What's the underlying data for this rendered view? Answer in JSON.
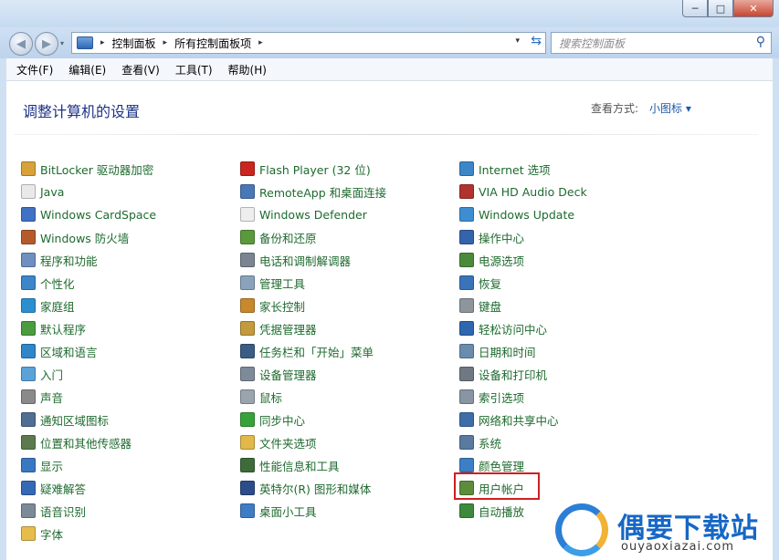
{
  "window": {
    "minimize": "─",
    "maximize": "□",
    "close": "✕"
  },
  "nav": {
    "back_glyph": "◀",
    "forward_glyph": "▶",
    "dropdown_glyph": "▾"
  },
  "address": {
    "crumbs": [
      "控制面板",
      "所有控制面板项"
    ],
    "separator": "▸",
    "dropdown_glyph": "▾",
    "refresh_glyph": "⇆"
  },
  "search": {
    "placeholder": "搜索控制面板",
    "icon_glyph": "⚲"
  },
  "menu": [
    "文件(F)",
    "编辑(E)",
    "查看(V)",
    "工具(T)",
    "帮助(H)"
  ],
  "page": {
    "title": "调整计算机的设置",
    "view_label": "查看方式:",
    "view_value": "小图标 ▾"
  },
  "items": [
    {
      "label": "BitLocker 驱动器加密",
      "icon": "key-icon",
      "color": "#d8a23a"
    },
    {
      "label": "Java",
      "icon": "document-icon",
      "color": "#e9e9e9"
    },
    {
      "label": "Windows CardSpace",
      "icon": "cardspace-icon",
      "color": "#3f72c4"
    },
    {
      "label": "Windows 防火墙",
      "icon": "firewall-icon",
      "color": "#b65a2c"
    },
    {
      "label": "程序和功能",
      "icon": "programs-icon",
      "color": "#6e8fbf"
    },
    {
      "label": "个性化",
      "icon": "personalize-icon",
      "color": "#3d86c9"
    },
    {
      "label": "家庭组",
      "icon": "homegroup-icon",
      "color": "#2b8fd0"
    },
    {
      "label": "默认程序",
      "icon": "default-programs-icon",
      "color": "#4a9c3f"
    },
    {
      "label": "区域和语言",
      "icon": "globe-icon",
      "color": "#2f86c9"
    },
    {
      "label": "入门",
      "icon": "getting-started-icon",
      "color": "#5aa2d8"
    },
    {
      "label": "声音",
      "icon": "speaker-icon",
      "color": "#8a8a8a"
    },
    {
      "label": "通知区域图标",
      "icon": "notification-icon",
      "color": "#4f6e92"
    },
    {
      "label": "位置和其他传感器",
      "icon": "sensor-icon",
      "color": "#5c7a4c"
    },
    {
      "label": "显示",
      "icon": "display-icon",
      "color": "#3a78c2"
    },
    {
      "label": "疑难解答",
      "icon": "troubleshoot-icon",
      "color": "#3569b5"
    },
    {
      "label": "语音识别",
      "icon": "microphone-icon",
      "color": "#7c8a98"
    },
    {
      "label": "字体",
      "icon": "folder-icon",
      "color": "#e6bd4c"
    },
    {
      "label": "Flash Player (32 位)",
      "icon": "flash-icon",
      "color": "#c8261f"
    },
    {
      "label": "RemoteApp 和桌面连接",
      "icon": "remoteapp-icon",
      "color": "#4978b8"
    },
    {
      "label": "Windows Defender",
      "icon": "document-icon",
      "color": "#eeeeee"
    },
    {
      "label": "备份和还原",
      "icon": "backup-icon",
      "color": "#5a9a3c"
    },
    {
      "label": "电话和调制解调器",
      "icon": "phone-icon",
      "color": "#7a8591"
    },
    {
      "label": "管理工具",
      "icon": "admin-tools-icon",
      "color": "#8aa2bb"
    },
    {
      "label": "家长控制",
      "icon": "parental-icon",
      "color": "#c8892b"
    },
    {
      "label": "凭据管理器",
      "icon": "credential-icon",
      "color": "#c39a3c"
    },
    {
      "label": "任务栏和「开始」菜单",
      "icon": "taskbar-icon",
      "color": "#3a5c85"
    },
    {
      "label": "设备管理器",
      "icon": "device-manager-icon",
      "color": "#7d8b99"
    },
    {
      "label": "鼠标",
      "icon": "mouse-icon",
      "color": "#9aa4ad"
    },
    {
      "label": "同步中心",
      "icon": "sync-icon",
      "color": "#37a23a"
    },
    {
      "label": "文件夹选项",
      "icon": "folder-options-icon",
      "color": "#e2b84a"
    },
    {
      "label": "性能信息和工具",
      "icon": "performance-icon",
      "color": "#3d6b3a"
    },
    {
      "label": "英特尔(R) 图形和媒体",
      "icon": "intel-icon",
      "color": "#2c4d8a"
    },
    {
      "label": "桌面小工具",
      "icon": "gadgets-icon",
      "color": "#3e7dc6"
    },
    {
      "label": "Internet 选项",
      "icon": "internet-icon",
      "color": "#3a86c8"
    },
    {
      "label": "VIA HD Audio Deck",
      "icon": "audio-icon",
      "color": "#b0332e"
    },
    {
      "label": "Windows Update",
      "icon": "windows-update-icon",
      "color": "#3d8ed0"
    },
    {
      "label": "操作中心",
      "icon": "flag-icon",
      "color": "#3464ac"
    },
    {
      "label": "电源选项",
      "icon": "power-icon",
      "color": "#4b8a3a"
    },
    {
      "label": "恢复",
      "icon": "recovery-icon",
      "color": "#3a74b8"
    },
    {
      "label": "键盘",
      "icon": "keyboard-icon",
      "color": "#8e959c"
    },
    {
      "label": "轻松访问中心",
      "icon": "ease-of-access-icon",
      "color": "#2f66b0"
    },
    {
      "label": "日期和时间",
      "icon": "clock-icon",
      "color": "#6a8cae"
    },
    {
      "label": "设备和打印机",
      "icon": "printer-icon",
      "color": "#6f7983"
    },
    {
      "label": "索引选项",
      "icon": "indexing-icon",
      "color": "#8895a3"
    },
    {
      "label": "网络和共享中心",
      "icon": "network-icon",
      "color": "#3e6ea8"
    },
    {
      "label": "系统",
      "icon": "system-icon",
      "color": "#5b7aa0"
    },
    {
      "label": "颜色管理",
      "icon": "color-management-icon",
      "color": "#3b7fc4"
    },
    {
      "label": "用户帐户",
      "icon": "user-accounts-icon",
      "color": "#5c8c3c"
    },
    {
      "label": "自动播放",
      "icon": "autoplay-icon",
      "color": "#3e8a3c"
    }
  ],
  "watermark": {
    "brand": "偶要下载站",
    "url": "ouyaoxiazai.com"
  },
  "colors": {
    "link": "#1e6a2e",
    "heading": "#1e3287",
    "highlight": "#d01f1f"
  }
}
